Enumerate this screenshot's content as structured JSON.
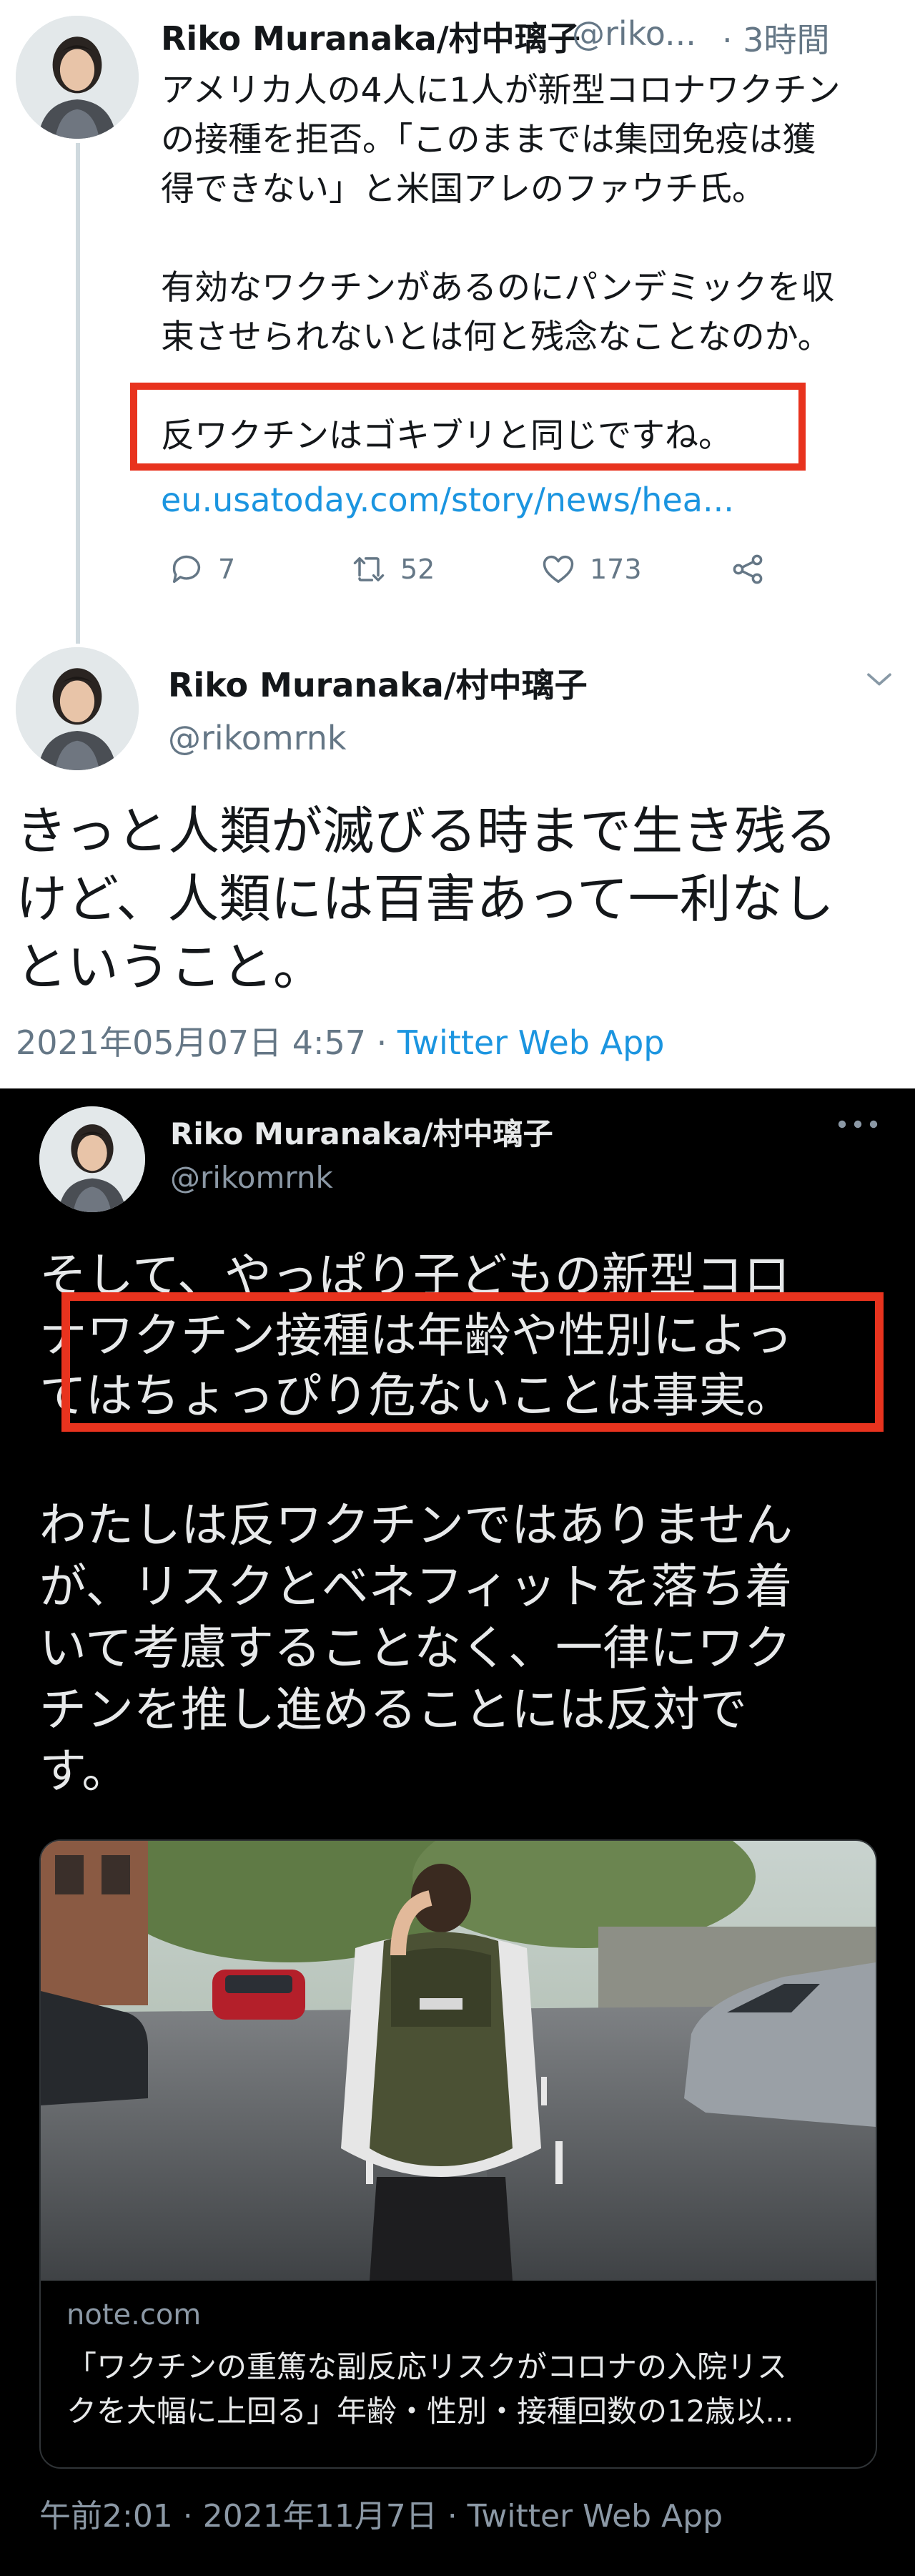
{
  "tweet1": {
    "name": "Riko Muranaka/村中璃子",
    "handle": "@riko...",
    "time": "· 3時間",
    "line1": "アメリカ人の4人に1人が新型コロナワクチン",
    "line2": "の接種を拒否。「このままでは集団免疫は獲",
    "line3": "得できない」と米国アレのファウチ氏。",
    "line4": "有効なワクチンがあるのにパンデミックを収",
    "line5": "束させられないとは何と残念なことなのか。",
    "line6": "反ワクチンはゴキブリと同じですね。",
    "link": "eu.usatoday.com/story/news/hea...",
    "replies": "7",
    "retweets": "52",
    "likes": "173"
  },
  "tweet2": {
    "name": "Riko Muranaka/村中璃子",
    "handle": "@rikomrnk",
    "line1": "きっと人類が滅びる時まで生き残る",
    "line2": "けど、人類には百害あって一利なし",
    "line3": "ということ。",
    "date": "2021年05月07日 4:57 · ",
    "source": "Twitter Web App"
  },
  "tweet3": {
    "name": "Riko Muranaka/村中璃子",
    "handle": "@rikomrnk",
    "line1": "そして、やっぱり子どもの新型コロ",
    "line2": "ナワクチン接種は年齢や性別によっ",
    "line3": "てはちょっぴり危ないことは事実。",
    "line4": "わたしは反ワクチンではありません",
    "line5": "が、リスクとベネフィットを落ち着",
    "line6": "いて考慮することなく、一律にワク",
    "line7": "チンを推し進めることには反対で",
    "line8": "す。",
    "card_domain": "note.com",
    "card_title1": "「ワクチンの重篤な副反応リスクがコロナの入院リス",
    "card_title2": "クを大幅に上回る」年齢・性別・接種回数の12歳以...",
    "meta": "午前2:01 · 2021年11月7日 · Twitter Web App"
  },
  "colors": {
    "highlight_box": "#e8331e",
    "link_blue": "#1b95e0",
    "dark_bg": "#000000",
    "light_bg": "#ffffff"
  }
}
